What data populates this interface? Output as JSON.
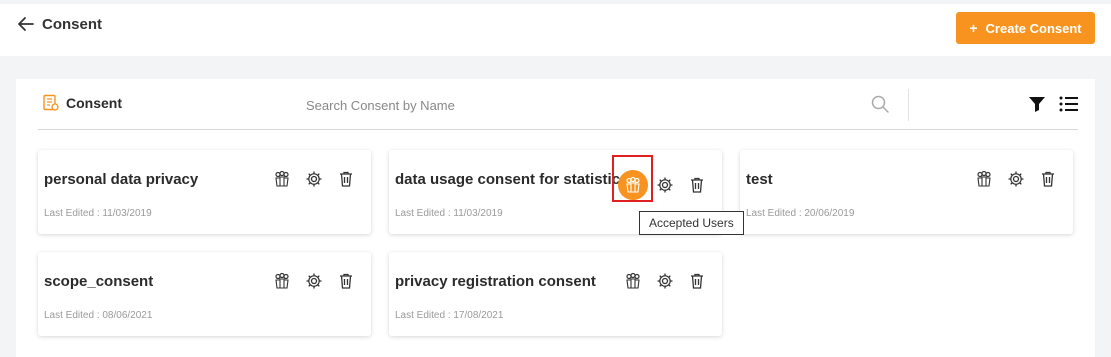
{
  "header": {
    "title": "Consent",
    "create_button": "Create Consent",
    "create_plus": "+"
  },
  "panel": {
    "title": "Consent",
    "search_placeholder": "Search Consent by Name"
  },
  "colors": {
    "accent": "#f7931e",
    "highlight_border": "#e02020"
  },
  "cards": [
    {
      "title": "personal data privacy",
      "date": "Last Edited : 11/03/2019"
    },
    {
      "title": "data usage consent for statistics",
      "date": "Last Edited : 11/03/2019"
    },
    {
      "title": "test",
      "date": "Last Edited : 20/06/2019"
    },
    {
      "title": "scope_consent",
      "date": "Last Edited : 08/06/2021"
    },
    {
      "title": "privacy registration consent",
      "date": "Last Edited : 17/08/2021"
    }
  ],
  "tooltip": "Accepted Users",
  "icons": [
    "back-arrow-icon",
    "consent-doc-icon",
    "search-icon",
    "filter-icon",
    "list-view-icon",
    "accepted-users-icon",
    "settings-icon",
    "delete-icon"
  ]
}
